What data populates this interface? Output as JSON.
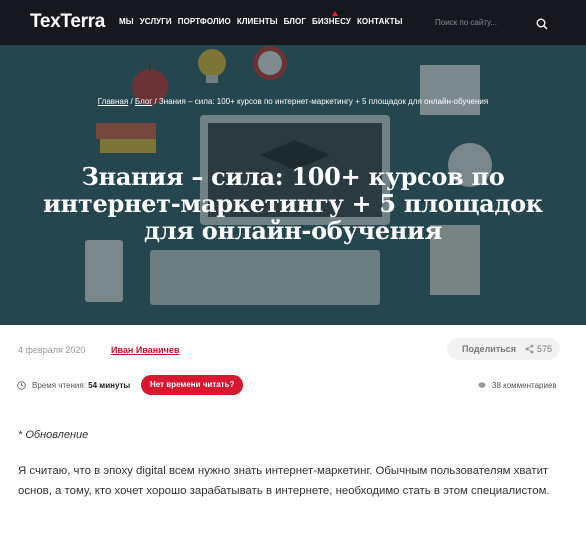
{
  "header": {
    "logo": "TexTerra",
    "nav": [
      "МЫ",
      "УСЛУГИ",
      "ПОРТФОЛИО",
      "КЛИЕНТЫ",
      "БЛОГ",
      "БИЗНЕСУ",
      "КОНТАКТЫ"
    ],
    "search_placeholder": "Поиск по сайту...",
    "accent_color": "#e0213a"
  },
  "hero": {
    "breadcrumb": {
      "home": "Главная",
      "sep1": "/",
      "blog": "Блог",
      "sep2": "/",
      "current": "Знания – сила: 100+ курсов по интернет-маркетингу + 5 площадок для онлайн-обучения"
    },
    "title": "Знания – сила: 100+ курсов по интернет-маркетингу + 5 площадок для онлайн-обучения"
  },
  "meta": {
    "date": "4 февраля 2020",
    "author": "Иван Иваничев",
    "share_label": "Поделиться",
    "share_count": "575",
    "read_time_label": "Время чтения:",
    "read_time_value": "54 минуты",
    "no_time_button": "Нет времени читать?",
    "comments": "38 комментариев",
    "button_color": "#d9172f"
  },
  "article": {
    "update_note": "* Обновление",
    "paragraph": "Я считаю, что в эпоху digital всем нужно знать интернет-маркетинг. Обычным пользователям хватит основ, а тому, кто хочет хорошо зарабатывать в интернете, необходимо стать в этом специалистом."
  }
}
